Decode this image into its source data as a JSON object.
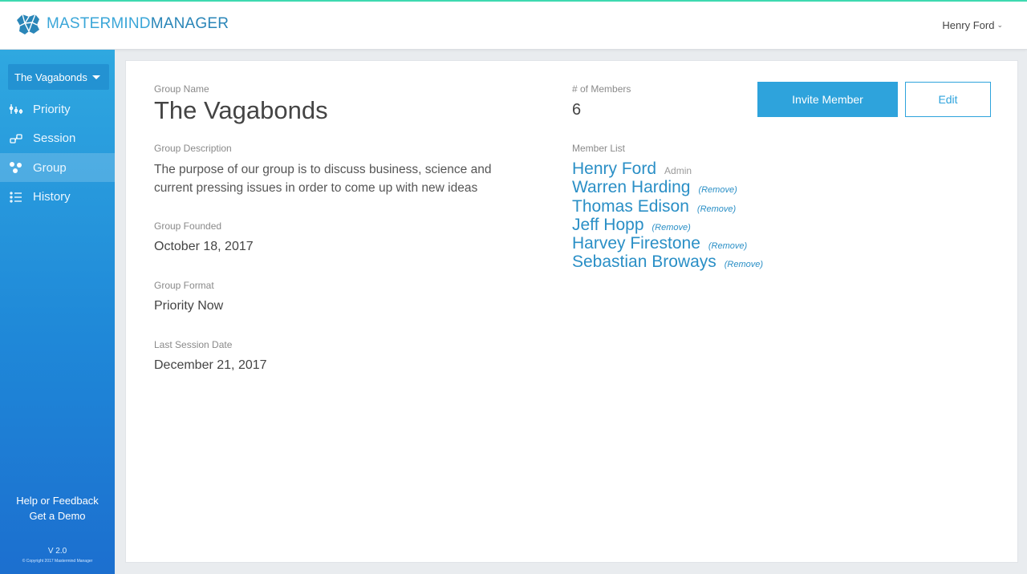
{
  "header": {
    "brand_part1": "MASTERMIND",
    "brand_part2": "MANAGER",
    "user_name": "Henry Ford"
  },
  "sidebar": {
    "group_selector": "The Vagabonds",
    "nav": [
      {
        "label": "Priority",
        "icon": "priority-icon"
      },
      {
        "label": "Session",
        "icon": "session-icon"
      },
      {
        "label": "Group",
        "icon": "group-icon",
        "active": true
      },
      {
        "label": "History",
        "icon": "history-icon"
      }
    ],
    "help_link": "Help or Feedback",
    "demo_link": "Get a Demo",
    "version": "V 2.0",
    "copyright": "© Copyright 2017 Mastermind Manager"
  },
  "group": {
    "name_label": "Group Name",
    "name": "The Vagabonds",
    "description_label": "Group Description",
    "description": "The purpose of our group is to discuss business, science and current pressing issues in order to come up with new ideas",
    "founded_label": "Group Founded",
    "founded": "October 18, 2017",
    "format_label": "Group Format",
    "format": "Priority Now",
    "last_session_label": "Last Session Date",
    "last_session": "December 21, 2017",
    "members_count_label": "# of Members",
    "members_count": "6",
    "member_list_label": "Member List"
  },
  "members": [
    {
      "name": "Henry Ford",
      "tag": "Admin"
    },
    {
      "name": "Warren Harding",
      "tag": "(Remove)"
    },
    {
      "name": "Thomas Edison",
      "tag": "(Remove)"
    },
    {
      "name": "Jeff Hopp",
      "tag": "(Remove)"
    },
    {
      "name": "Harvey Firestone",
      "tag": "(Remove)"
    },
    {
      "name": "Sebastian Broways",
      "tag": "(Remove)"
    }
  ],
  "actions": {
    "invite_label": "Invite Member",
    "edit_label": "Edit"
  },
  "colors": {
    "accent": "#2ea3dc",
    "sidebar_top": "#2fa8e0",
    "sidebar_bottom": "#1c6fcf",
    "top_border": "#3ed9b0"
  }
}
